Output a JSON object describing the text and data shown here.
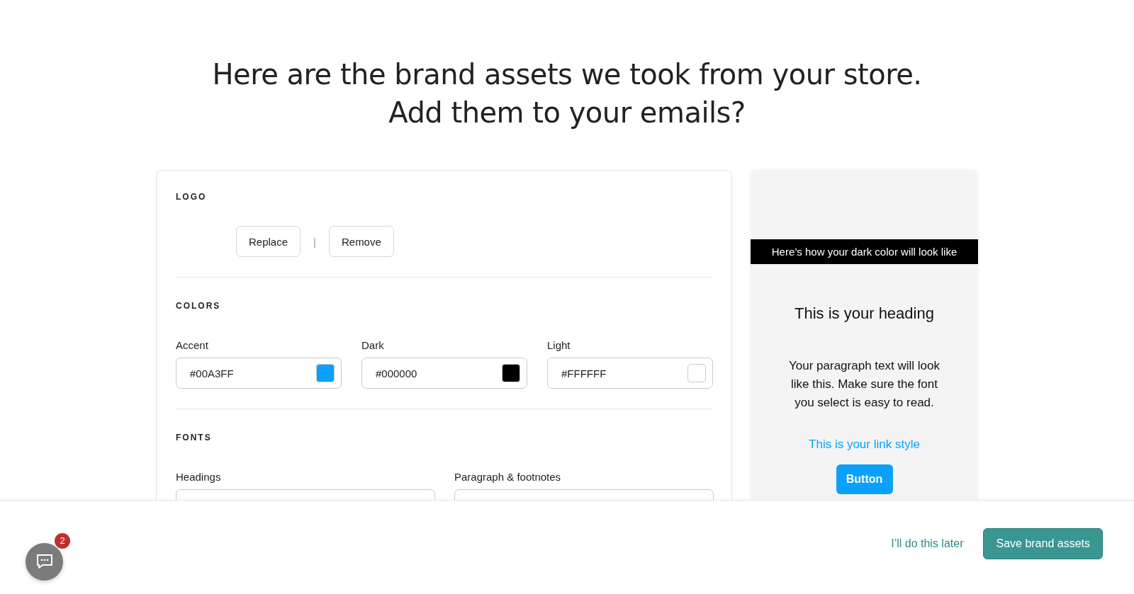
{
  "heading": [
    "Here are the brand assets we took from your store.",
    "Add them to your emails?"
  ],
  "logo": {
    "label": "LOGO",
    "buttons": [
      "Replace",
      "Remove"
    ],
    "separator": "|"
  },
  "colors": {
    "label": "COLORS",
    "items": [
      {
        "label": "Accent",
        "value": "#00A3FF",
        "color": "#0aa0fb"
      },
      {
        "label": "Dark",
        "value": "#000000",
        "color": "#000000"
      },
      {
        "label": "Light",
        "value": "#FFFFFF",
        "color": "#ffffff"
      }
    ]
  },
  "fonts": {
    "label": "FONTS",
    "items": [
      {
        "label": "Headings"
      },
      {
        "label": "Paragraph & footnotes"
      }
    ]
  },
  "preview": {
    "dark_bar": "Here’s how your dark color will look like",
    "heading": "This is your heading",
    "paragraph": "Your paragraph text will look like this. Make sure the font you select is easy to read.",
    "link": "This is your link style",
    "button": "Button"
  },
  "footer": {
    "chat_badge": "2",
    "later": "I’ll do this later",
    "save": "Save brand assets"
  }
}
